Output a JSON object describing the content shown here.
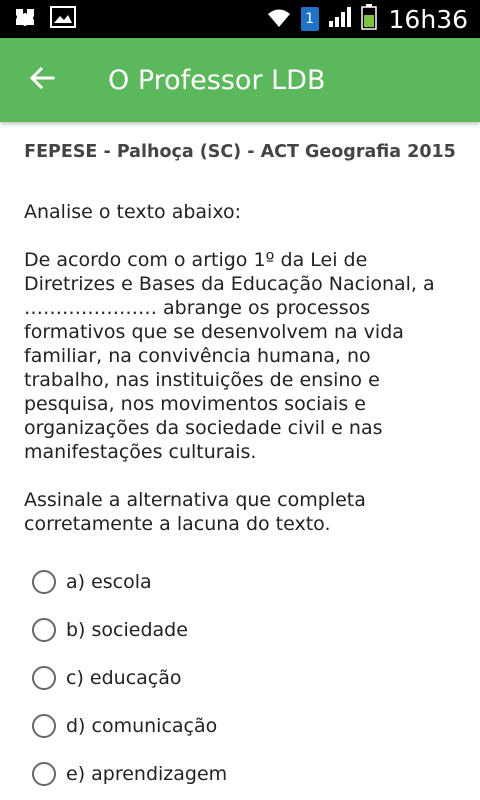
{
  "status_bar": {
    "time": "16h36",
    "sim_slot": "1",
    "icons": [
      "puzzle-notification-icon",
      "image-notification-icon",
      "wifi-icon",
      "signal-icon",
      "battery-icon"
    ]
  },
  "app_bar": {
    "title": "O Professor LDB",
    "back_icon": "arrow-back-icon",
    "color": "#5cb85c"
  },
  "exam": {
    "title": "FEPESE - Palhoça (SC) - ACT Geografia 2015"
  },
  "question": {
    "text": "Analise o texto abaixo:\n\n De acordo com o artigo 1º da Lei de Diretrizes e Bases da Educação Nacional, a ………………… abrange os processos formativos que se desenvolvem na vida familiar, na convivência humana, no trabalho, nas instituições de ensino e pesquisa, nos movimentos sociais e organizações da sociedade civil e nas manifestações culturais.\n\n Assinale a alternativa que completa corretamente a lacuna do texto."
  },
  "options": [
    {
      "label": "a) escola"
    },
    {
      "label": "b) sociedade"
    },
    {
      "label": "c) educação"
    },
    {
      "label": "d) comunicação"
    },
    {
      "label": "e) aprendizagem"
    }
  ]
}
